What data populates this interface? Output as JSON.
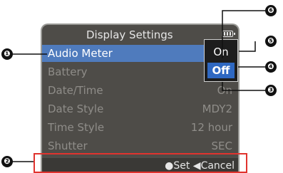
{
  "title": "Display Settings",
  "status": {
    "battery_icon": "battery-icon"
  },
  "menu": [
    {
      "label": "Audio Meter",
      "value": ""
    },
    {
      "label": "Battery",
      "value": ""
    },
    {
      "label": "Date/Time",
      "value": "On"
    },
    {
      "label": "Date Style",
      "value": "MDY2"
    },
    {
      "label": "Time Style",
      "value": "12 hour"
    },
    {
      "label": "Shutter",
      "value": "SEC"
    }
  ],
  "options": [
    {
      "label": "On",
      "selected": false
    },
    {
      "label": "Off",
      "selected": true
    }
  ],
  "footer": {
    "set_label": "●Set",
    "cancel_label": "◀Cancel"
  },
  "callouts": [
    "❶",
    "❷",
    "❸",
    "❹",
    "❺",
    "❻"
  ],
  "colors": {
    "highlight": "#4f7bbd",
    "option_highlight": "#2e68c2",
    "callout_box": "#e0332e"
  }
}
